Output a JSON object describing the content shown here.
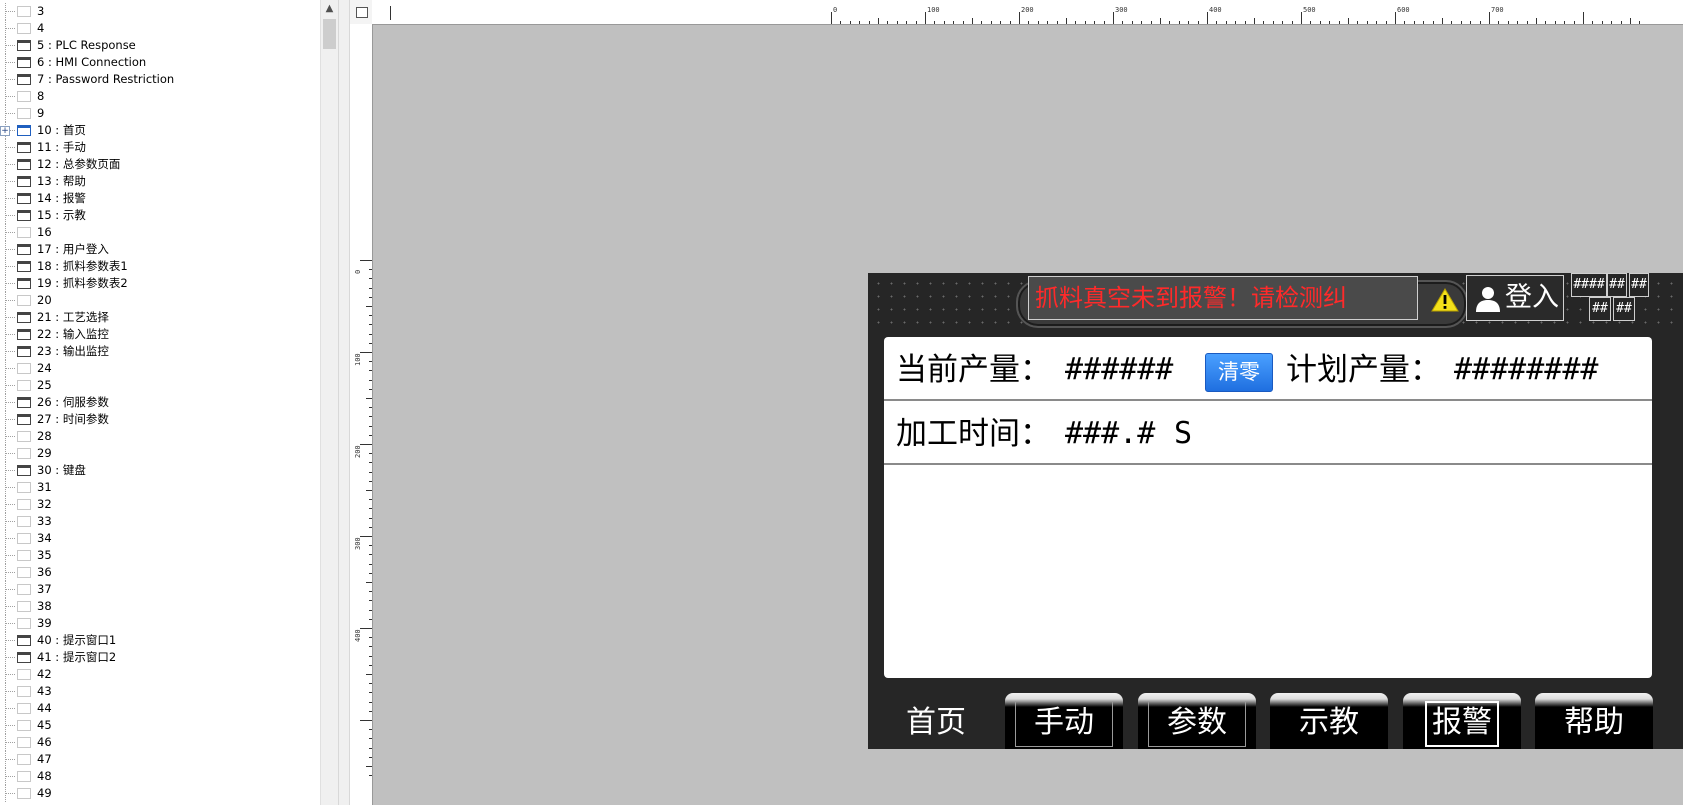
{
  "tree": {
    "items": [
      {
        "id": "3",
        "name": ""
      },
      {
        "id": "4",
        "name": ""
      },
      {
        "id": "5",
        "name": "PLC Response"
      },
      {
        "id": "6",
        "name": "HMI Connection"
      },
      {
        "id": "7",
        "name": "Password Restriction"
      },
      {
        "id": "8",
        "name": ""
      },
      {
        "id": "9",
        "name": ""
      },
      {
        "id": "10",
        "name": "首页"
      },
      {
        "id": "11",
        "name": "手动"
      },
      {
        "id": "12",
        "name": "总参数页面"
      },
      {
        "id": "13",
        "name": "帮助"
      },
      {
        "id": "14",
        "name": "报警"
      },
      {
        "id": "15",
        "name": "示教"
      },
      {
        "id": "16",
        "name": ""
      },
      {
        "id": "17",
        "name": "用户登入"
      },
      {
        "id": "18",
        "name": "抓料参数表1"
      },
      {
        "id": "19",
        "name": "抓料参数表2"
      },
      {
        "id": "20",
        "name": ""
      },
      {
        "id": "21",
        "name": "工艺选择"
      },
      {
        "id": "22",
        "name": "输入监控"
      },
      {
        "id": "23",
        "name": "输出监控"
      },
      {
        "id": "24",
        "name": ""
      },
      {
        "id": "25",
        "name": ""
      },
      {
        "id": "26",
        "name": "伺服参数"
      },
      {
        "id": "27",
        "name": "时间参数"
      },
      {
        "id": "28",
        "name": ""
      },
      {
        "id": "29",
        "name": ""
      },
      {
        "id": "30",
        "name": "键盘"
      },
      {
        "id": "31",
        "name": ""
      },
      {
        "id": "32",
        "name": ""
      },
      {
        "id": "33",
        "name": ""
      },
      {
        "id": "34",
        "name": ""
      },
      {
        "id": "35",
        "name": ""
      },
      {
        "id": "36",
        "name": ""
      },
      {
        "id": "37",
        "name": ""
      },
      {
        "id": "38",
        "name": ""
      },
      {
        "id": "39",
        "name": ""
      },
      {
        "id": "40",
        "name": "提示窗口1"
      },
      {
        "id": "41",
        "name": "提示窗口2"
      },
      {
        "id": "42",
        "name": ""
      },
      {
        "id": "43",
        "name": ""
      },
      {
        "id": "44",
        "name": ""
      },
      {
        "id": "45",
        "name": ""
      },
      {
        "id": "46",
        "name": ""
      },
      {
        "id": "47",
        "name": ""
      },
      {
        "id": "48",
        "name": ""
      },
      {
        "id": "49",
        "name": ""
      }
    ],
    "active_id": "10"
  },
  "rulers": {
    "horizontal_labels": [
      "0",
      "100",
      "200",
      "300",
      "400",
      "500",
      "600",
      "700"
    ],
    "vertical_labels": [
      "0",
      "100",
      "200",
      "300",
      "400"
    ]
  },
  "hmi": {
    "alarm_text": "抓料真空未到报警！请检测纠",
    "login_label": "登入",
    "hash_boxes": [
      "####",
      "##",
      "##",
      "##",
      "##"
    ],
    "production": {
      "current_label": "当前产量：",
      "current_value": "######",
      "clear_button": "清零",
      "planned_label": "计划产量：",
      "planned_value": "########"
    },
    "process_time": {
      "label": "加工时间：",
      "value": "###.#",
      "unit": "S"
    },
    "nav_tabs": [
      "首页",
      "手动",
      "参数",
      "示教",
      "报警",
      "帮助"
    ],
    "active_tab": "首页"
  },
  "colors": {
    "alarm_text": "#ff2a2a",
    "clear_button": "#2f86f0",
    "hmi_background": "#262626",
    "canvas_background": "#c0c0c0"
  }
}
